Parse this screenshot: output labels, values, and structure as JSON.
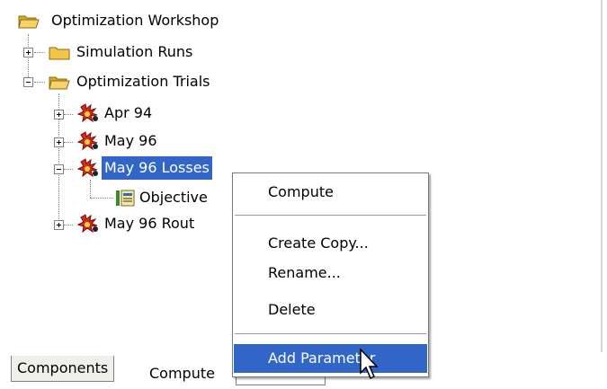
{
  "tree": {
    "root": "Optimization Workshop",
    "simulation_runs": "Simulation Runs",
    "optimization_trials": "Optimization Trials",
    "trials": [
      {
        "label": "Apr 94",
        "expanded": false
      },
      {
        "label": "May 96",
        "expanded": false
      },
      {
        "label": "May 96 Losses",
        "expanded": true,
        "selected": true
      },
      {
        "label": "May 96 Rout",
        "expanded": false
      }
    ],
    "child_objective": "Objective"
  },
  "context_menu": {
    "items": [
      "Compute",
      "Create Copy...",
      "Rename...",
      "Delete",
      "Add Parameter"
    ],
    "highlighted": "Add Parameter"
  },
  "tabs": [
    "Components",
    "Compute",
    ""
  ],
  "colors": {
    "selection": "#3166c8",
    "folder": "#f2c64a",
    "trial_icon": "#c8201c"
  }
}
